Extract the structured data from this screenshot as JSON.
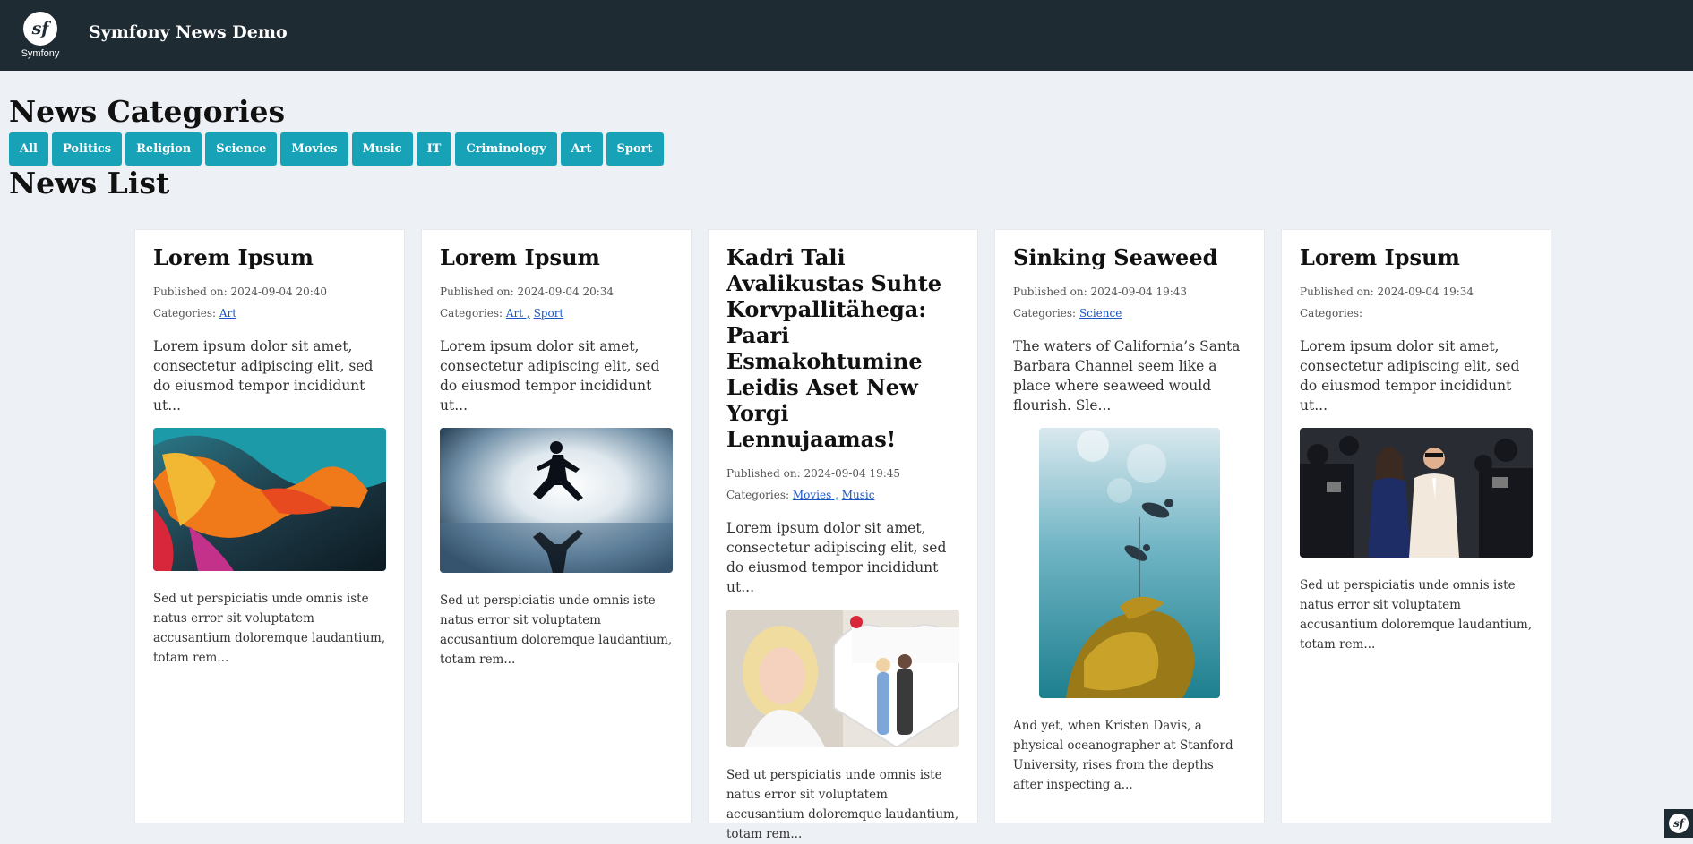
{
  "header": {
    "logo_text": "Symfony",
    "logo_mark": "sf",
    "title": "Symfony News Demo"
  },
  "categories_section": {
    "heading": "News Categories",
    "buttons": [
      "All",
      "Politics",
      "Religion",
      "Science",
      "Movies",
      "Music",
      "IT",
      "Criminology",
      "Art",
      "Sport"
    ]
  },
  "list_section": {
    "heading": "News List"
  },
  "published_prefix": "Published on:",
  "categories_prefix": "Categories:",
  "articles": [
    {
      "title": "Lorem Ipsum",
      "published": "2024-09-04 20:40",
      "categories": [
        "Art"
      ],
      "excerpt": "Lorem ipsum dolor sit amet, consectetur adipiscing elit, sed do eiusmod tempor incididunt ut...",
      "image": "abstract-paint-splash-image",
      "more": "Sed ut perspiciatis unde omnis iste natus error sit voluptatem accusantium doloremque laudantium, totam rem..."
    },
    {
      "title": "Lorem Ipsum",
      "published": "2024-09-04 20:34",
      "categories": [
        "Art ,",
        "Sport"
      ],
      "excerpt": "Lorem ipsum dolor sit amet, consectetur adipiscing elit, sed do eiusmod tempor incididunt ut...",
      "image": "runner-silhouette-image",
      "more": "Sed ut perspiciatis unde omnis iste natus error sit voluptatem accusantium doloremque laudantium, totam rem..."
    },
    {
      "title": "Kadri Tali Avalikustas Suhte Korvpallitähega: Paari Esmakohtumine Leidis Aset New Yorgi Lennujaamas!",
      "published": "2024-09-04 19:45",
      "categories": [
        "Movies ,",
        "Music"
      ],
      "excerpt": "Lorem ipsum dolor sit amet, consectetur adipiscing elit, sed do eiusmod tempor incididunt ut...",
      "image": "portrait-with-heart-image",
      "more": "Sed ut perspiciatis unde omnis iste natus error sit voluptatem accusantium doloremque laudantium, totam rem..."
    },
    {
      "title": "Sinking Seaweed",
      "published": "2024-09-04 19:43",
      "categories": [
        "Science"
      ],
      "excerpt": "The waters of California’s Santa Barbara Channel seem like a place where seaweed would flourish. Sle...",
      "image": "underwater-divers-image",
      "more": "And yet, when Kristen Davis, a physical oceanographer at Stanford University, rises from the depths after inspecting a..."
    },
    {
      "title": "Lorem Ipsum",
      "published": "2024-09-04 19:34",
      "categories": [],
      "excerpt": "Lorem ipsum dolor sit amet, consectetur adipiscing elit, sed do eiusmod tempor incididunt ut...",
      "image": "red-carpet-photo-image",
      "more": "Sed ut perspiciatis unde omnis iste natus error sit voluptatem accusantium doloremque laudantium, totam rem..."
    }
  ],
  "colors": {
    "header_bg": "#1f2b33",
    "page_bg": "#edf0f4",
    "button_bg": "#17a2b8",
    "link": "#1a56c4"
  }
}
